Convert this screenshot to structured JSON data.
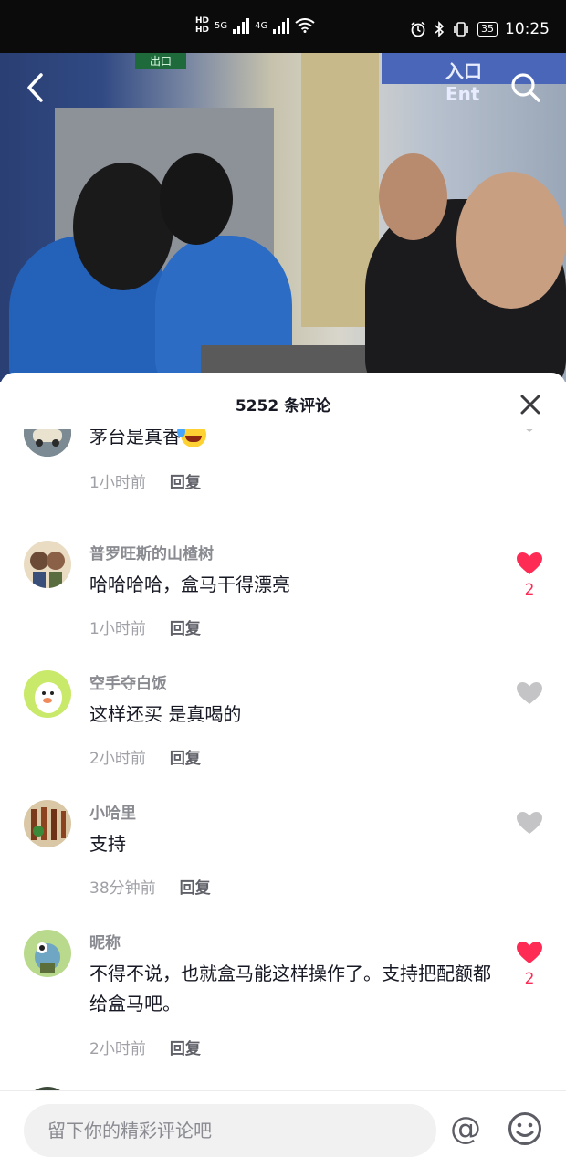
{
  "status_bar": {
    "hd1": "HD",
    "hd2": "HD",
    "net1": "5G",
    "net2": "4G",
    "battery": "35",
    "time": "10:25"
  },
  "video": {
    "exit_sign": "出口",
    "entrance_sign": "入口 Ent"
  },
  "comments_panel": {
    "title": "5252 条评论"
  },
  "comments": [
    {
      "name": "",
      "text": "茅台是真香",
      "emoji": "laughing-tears",
      "time": "1小时前",
      "reply": "回复",
      "liked": false,
      "like_count": ""
    },
    {
      "name": "普罗旺斯的山楂树",
      "text": "哈哈哈哈，盒马干得漂亮",
      "time": "1小时前",
      "reply": "回复",
      "liked": true,
      "like_count": "2"
    },
    {
      "name": "空手夺白饭",
      "text": "这样还买 是真喝的",
      "time": "2小时前",
      "reply": "回复",
      "liked": false,
      "like_count": ""
    },
    {
      "name": "小哈里",
      "text": "支持",
      "time": "38分钟前",
      "reply": "回复",
      "liked": false,
      "like_count": ""
    },
    {
      "name": "昵称",
      "text": "不得不说，也就盒马能这样操作了。支持把配额都给盒马吧。",
      "time": "2小时前",
      "reply": "回复",
      "liked": true,
      "like_count": "2"
    }
  ],
  "input": {
    "placeholder": "留下你的精彩评论吧",
    "at_symbol": "@"
  },
  "colors": {
    "liked": "#fe2c55",
    "unliked": "#c4c4c6"
  }
}
